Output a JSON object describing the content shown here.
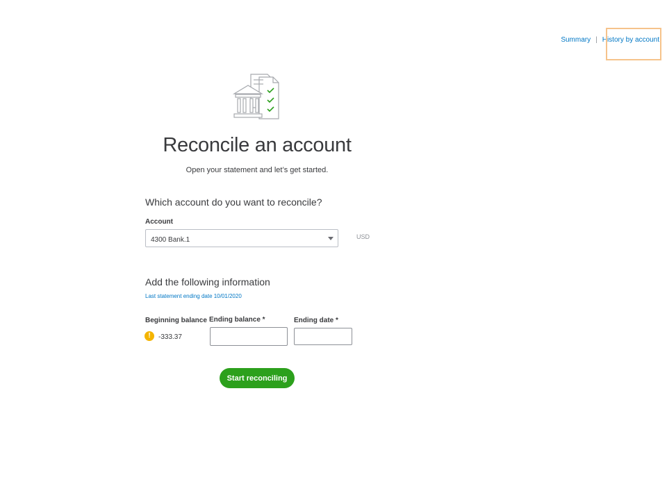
{
  "top_nav": {
    "summary_label": "Summary",
    "separator": "|",
    "history_label": "History by account"
  },
  "hero": {
    "icon": "bank-statement-checklist-icon",
    "title": "Reconcile an account",
    "subtitle": "Open your statement and let’s get started."
  },
  "account_section": {
    "question": "Which account do you want to reconcile?",
    "account_label": "Account",
    "account_value": "4300 Bank.1",
    "currency": "USD"
  },
  "info_section": {
    "heading": "Add the following information",
    "last_statement": "Last statement ending date 10/01/2020",
    "beginning_balance_label": "Beginning balance",
    "beginning_balance_value": "-333.37",
    "warning_icon": "warning-icon",
    "ending_balance_label": "Ending balance *",
    "ending_balance_value": "",
    "ending_date_label": "Ending date *",
    "ending_date_value": ""
  },
  "actions": {
    "start_label": "Start reconciling"
  },
  "colors": {
    "link": "#0077c5",
    "primary_button": "#2ca01c",
    "check": "#2ca01c",
    "warning": "#f4b400",
    "highlight": "#f6c38b"
  }
}
